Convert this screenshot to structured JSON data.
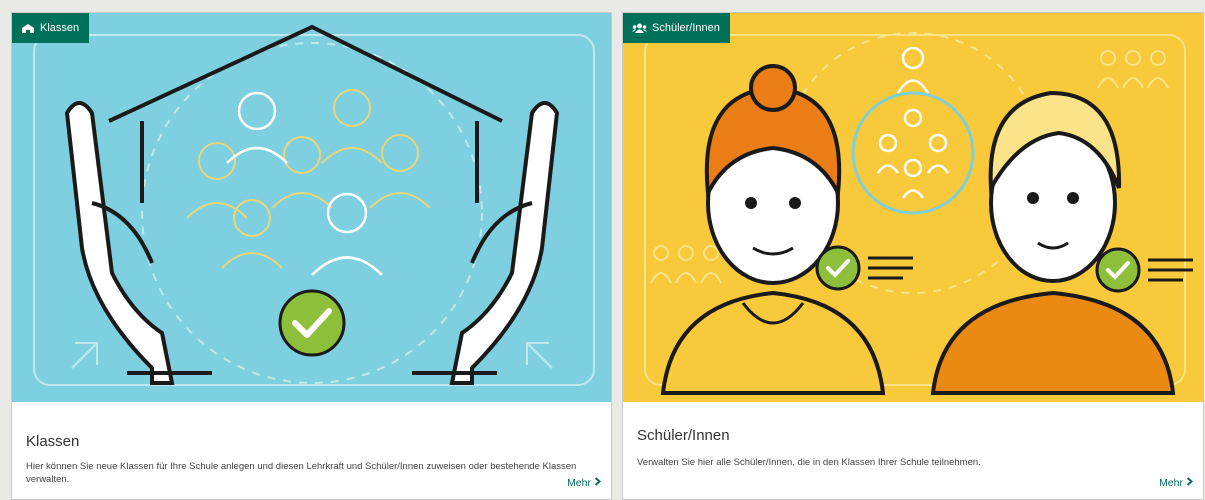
{
  "cards": [
    {
      "tag_label": "Klassen",
      "tag_icon": "school-icon",
      "title": "Klassen",
      "description": "Hier können Sie neue Klassen für Ihre Schule anlegen und diesen Lehrkraft und Schüler/Innen zuweisen oder bestehende Klassen verwalten.",
      "more_label": "Mehr",
      "illustration": "hands-protecting-class-illustration",
      "background_color": "#7ecfdf"
    },
    {
      "tag_label": "Schüler/Innen",
      "tag_icon": "users-icon",
      "title": "Schüler/Innen",
      "description": "Verwalten Sie hier alle Schüler/Innen, die in den Klassen Ihrer Schule teilnehmen.",
      "more_label": "Mehr",
      "illustration": "students-checked-illustration",
      "background_color": "#f8c93a"
    }
  ],
  "colors": {
    "accent": "#00705a",
    "check_green": "#8dbf3a"
  }
}
